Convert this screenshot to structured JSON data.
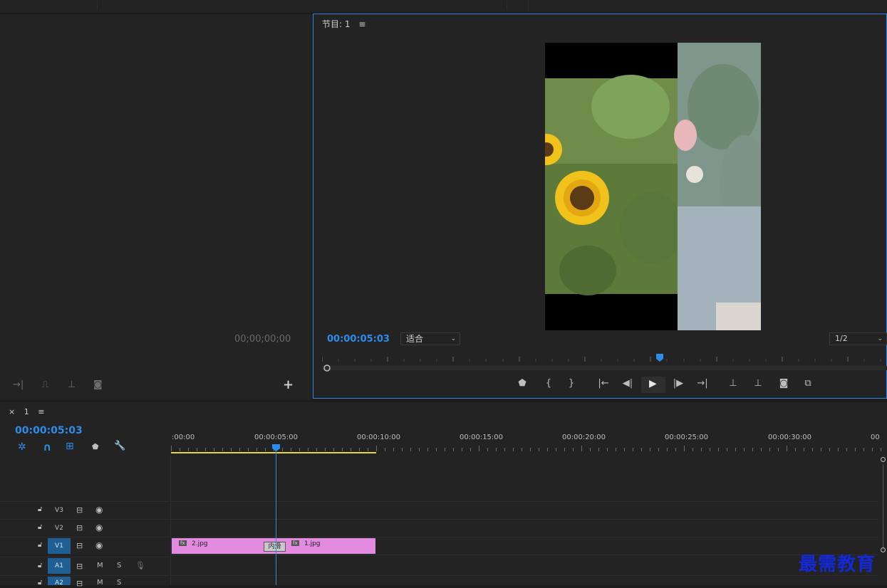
{
  "source_monitor": {
    "timecode": "00;00;00;00",
    "buttons": {
      "insert": "→|",
      "overwrite": "⎍",
      "lift": "⊥",
      "camera": "◙",
      "add": "+"
    }
  },
  "program_monitor": {
    "title": "节目: 1",
    "menu_icon": "≡",
    "timecode": "00:00:05:03",
    "fit_label": "适合",
    "resolution": "1/2",
    "controls": {
      "marker": "⬟",
      "mark_in": "{",
      "mark_out": "}",
      "go_in": "|←",
      "step_back": "◀|",
      "play": "▶",
      "step_fwd": "|▶",
      "go_out": "→|",
      "lift": "⊥",
      "extract": "⊥",
      "export_frame": "◙",
      "compare": "⧉"
    }
  },
  "timeline": {
    "close": "×",
    "sequence_name": "1",
    "menu_icon": "≡",
    "timecode": "00:00:05:03",
    "ruler_labels": [
      ":00:00",
      "00:00:05:00",
      "00:00:10:00",
      "00:00:15:00",
      "00:00:20:00",
      "00:00:25:00",
      "00:00:30:00",
      "00"
    ],
    "tools": {
      "snap": "✲",
      "magnet": "∩",
      "linked": "⊞",
      "marker": "⬟",
      "wrench": "🔧"
    },
    "tracks": {
      "v3": "V3",
      "v2": "V2",
      "v1": "V1",
      "a1": "A1",
      "a2": "A2",
      "mute": "M",
      "solo": "S"
    },
    "clips": {
      "clip_a": "2.jpg",
      "clip_b": "1.jpg",
      "transition": "内滑",
      "fx": "fx"
    }
  },
  "watermark": "最需教育",
  "colors": {
    "accent": "#2d8ceb",
    "clip": "#e38be0",
    "work_area": "#e8d63a",
    "watermark": "#1428d8"
  }
}
